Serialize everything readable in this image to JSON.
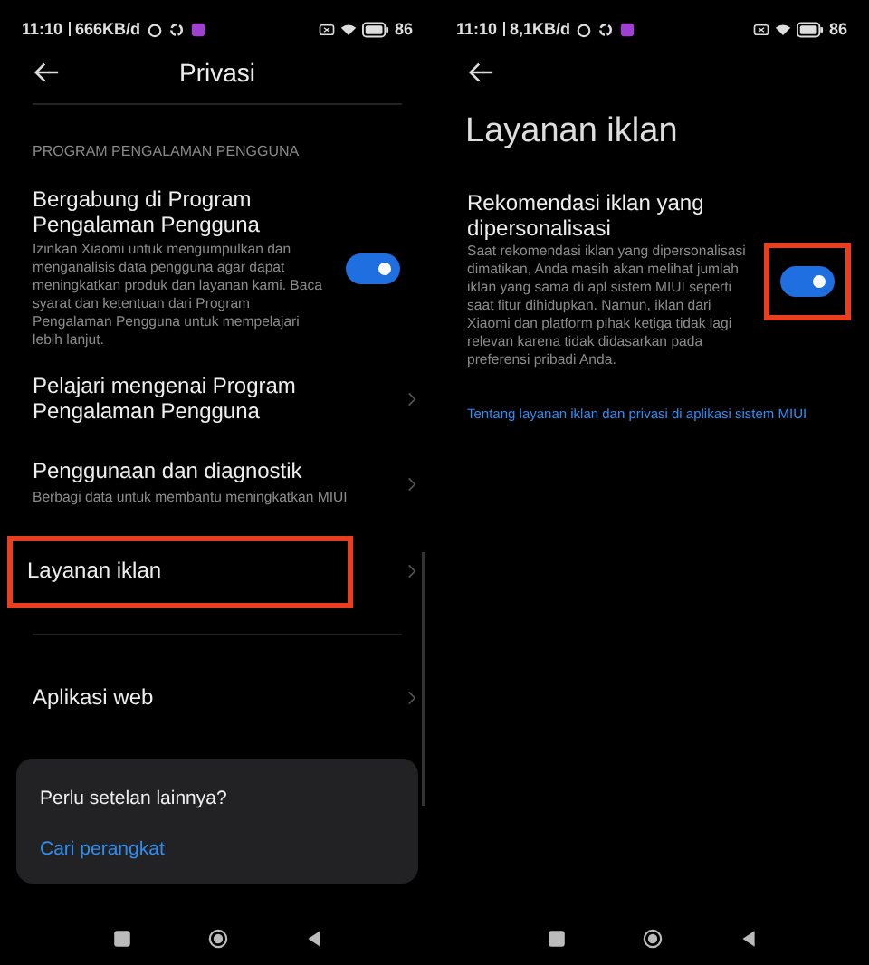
{
  "left_screen": {
    "status_bar": {
      "time": "11:10",
      "speed": "666KB/d",
      "battery": "86"
    },
    "header": {
      "title": "Privasi"
    },
    "section_label": "PROGRAM PENGALAMAN PENGGUNA",
    "items": [
      {
        "kind": "toggle",
        "title": "Bergabung di Program Pengalaman Pengguna",
        "description": "Izinkan Xiaomi untuk mengumpulkan dan menganalisis data pengguna agar dapat meningkatkan produk dan layanan kami. Baca syarat dan ketentuan dari Program Pengalaman Pengguna untuk mempelajari lebih lanjut.",
        "on": true,
        "highlighted": false
      },
      {
        "kind": "link",
        "title": "Pelajari mengenai Program Pengalaman Pengguna",
        "highlighted": false
      },
      {
        "kind": "link",
        "title": "Penggunaan dan diagnostik",
        "description": "Berbagi data untuk membantu meningkatkan MIUI",
        "highlighted": false
      },
      {
        "kind": "link",
        "title": "Layanan iklan",
        "highlighted": true
      },
      {
        "kind": "divider"
      },
      {
        "kind": "link",
        "title": "Aplikasi web",
        "highlighted": false
      }
    ],
    "card": {
      "question": "Perlu setelan lainnya?",
      "link": "Cari perangkat"
    }
  },
  "right_screen": {
    "status_bar": {
      "time": "11:10",
      "speed": "8,1KB/d",
      "battery": "86"
    },
    "header": {
      "title": "Layanan iklan"
    },
    "items": [
      {
        "kind": "toggle",
        "title": "Rekomendasi iklan yang dipersonalisasi",
        "description": "Saat rekomendasi iklan yang dipersonalisasi dimatikan, Anda masih akan melihat jumlah iklan yang sama di apl sistem MIUI seperti saat fitur dihidupkan. Namun, iklan dari Xiaomi dan platform pihak ketiga tidak lagi relevan karena tidak didasarkan pada preferensi pribadi Anda.",
        "on": true,
        "highlighted": true
      }
    ],
    "link": "Tentang layanan iklan dan privasi di aplikasi sistem MIUI"
  }
}
